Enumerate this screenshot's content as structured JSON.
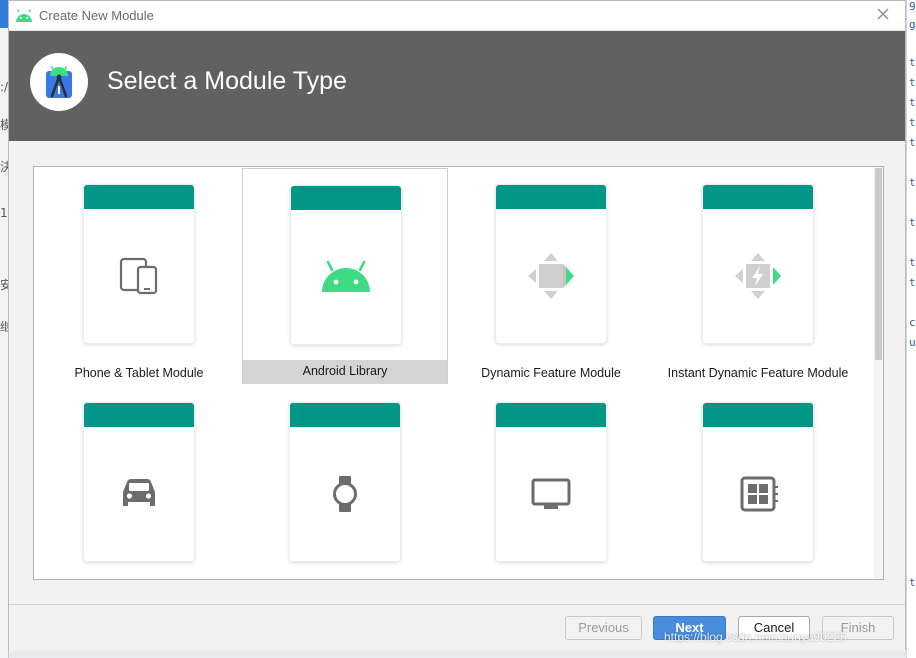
{
  "window": {
    "title": "Create New Module",
    "app_icon": "android-icon",
    "close_icon": "close-icon"
  },
  "header": {
    "title": "Select a Module Type",
    "logo_icon": "android-studio-icon"
  },
  "colors": {
    "header_bg": "#616161",
    "card_band": "#009788",
    "android_green": "#3ddc84",
    "primary_button": "#4a8cdc"
  },
  "modules": [
    {
      "label": "Phone & Tablet Module",
      "icon": "phone-tablet-icon",
      "selected": false
    },
    {
      "label": "Android Library",
      "icon": "android-icon",
      "selected": true
    },
    {
      "label": "Dynamic Feature Module",
      "icon": "dynamic-feature-icon",
      "selected": false
    },
    {
      "label": "Instant Dynamic Feature Module",
      "icon": "instant-dynamic-feature-icon",
      "selected": false
    },
    {
      "label": "",
      "icon": "car-icon",
      "selected": false
    },
    {
      "label": "",
      "icon": "watch-icon",
      "selected": false
    },
    {
      "label": "",
      "icon": "tv-icon",
      "selected": false
    },
    {
      "label": "",
      "icon": "things-board-icon",
      "selected": false
    }
  ],
  "buttons": {
    "previous": "Previous",
    "next": "Next",
    "cancel": "Cancel",
    "finish": "Finish"
  },
  "watermark": "https://blog.csdn.net/chunyu90225",
  "background_editor": {
    "left_glyphs": [
      ":/",
      "模",
      "決",
      "1",
      "安",
      "继"
    ],
    "right_glyphs": [
      "9",
      "g",
      "t",
      "t",
      "t",
      "t",
      "t",
      "t",
      "t",
      "t",
      "t",
      "c",
      "u",
      "t"
    ]
  }
}
